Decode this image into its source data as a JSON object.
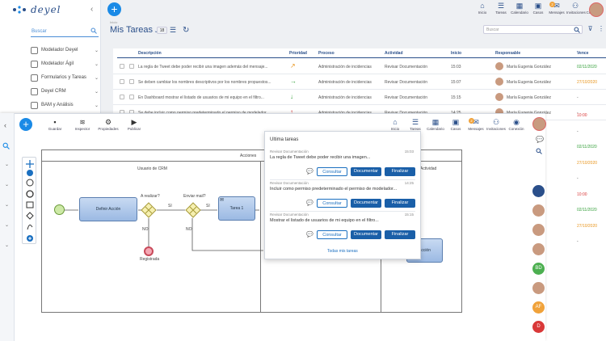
{
  "back": {
    "logo": "deyel",
    "search_placeholder": "Buscar",
    "sidebar": [
      "Modelador Deyel",
      "Modelador Ágil",
      "Formularios y Tareas",
      "Deyel CRM",
      "BAM y Análisis"
    ],
    "toolbar": [
      {
        "label": "Inicio",
        "icon": "home-icon"
      },
      {
        "label": "Tareas",
        "icon": "tasks-icon"
      },
      {
        "label": "Calendario",
        "icon": "calendar-icon"
      },
      {
        "label": "Casos",
        "icon": "briefcase-icon"
      },
      {
        "label": "Mensajes",
        "icon": "messages-icon",
        "badge": "2"
      },
      {
        "label": "Invitaciones",
        "icon": "invite-icon"
      },
      {
        "label": "Conexión",
        "icon": "connection-icon"
      }
    ],
    "breadcrumb": "Inicio",
    "title": "Mis Tareas",
    "count": "18",
    "search_placeholder_tasks": "Buscar",
    "columns": [
      "Descripción",
      "Prioridad",
      "Proceso",
      "Actividad",
      "Inicio",
      "Responsable",
      "Vence"
    ],
    "rows": [
      {
        "desc": "La regla de Tweet debe poder recibir una imagen además del mensaje...",
        "priority": "↗",
        "proceso": "Administración de incidencias",
        "actividad": "Revisar Documentación",
        "inicio": "15:03",
        "resp": "María Eugenia González",
        "vence": "02/11/2020",
        "vclass": "grn",
        "pclass": "org"
      },
      {
        "desc": "Se deben cambiar los nombres descriptivos por los nombres propuestos...",
        "priority": "→",
        "proceso": "Administración de incidencias",
        "actividad": "Revisar Documentación",
        "inicio": "15:07",
        "resp": "María Eugenia González",
        "vence": "27/10/2020",
        "vclass": "org",
        "pclass": "grn"
      },
      {
        "desc": "En Dashboard mostrar el listado de usuarios de mi equipo en el filtro...",
        "priority": "↓",
        "proceso": "Administración de incidencias",
        "actividad": "Revisar Documentación",
        "inicio": "15:15",
        "resp": "María Eugenia González",
        "vence": "-",
        "vclass": "",
        "pclass": "grn"
      },
      {
        "desc": "Se debe incluir como permiso predeterminado el permiso de modelador...",
        "priority": "↑",
        "proceso": "Administración de incidencias",
        "actividad": "Revisar Documentación",
        "inicio": "14:25",
        "resp": "María Eugenia González",
        "vence": "-",
        "vclass": "",
        "pclass": "red"
      }
    ],
    "right_dates": [
      {
        "v": "10:00",
        "c": "red"
      },
      {
        "v": "-",
        "c": ""
      },
      {
        "v": "02/11/2020",
        "c": "grn"
      },
      {
        "v": "27/10/2020",
        "c": "org"
      },
      {
        "v": "-",
        "c": ""
      },
      {
        "v": "10:00",
        "c": "red"
      },
      {
        "v": "02/11/2020",
        "c": "grn"
      },
      {
        "v": "27/10/2020",
        "c": "org"
      },
      {
        "v": "-",
        "c": ""
      }
    ]
  },
  "front": {
    "tools": [
      {
        "label": "Guardar",
        "icon": "save-icon"
      },
      {
        "label": "Inspector",
        "icon": "layers-icon"
      },
      {
        "label": "Propiedades",
        "icon": "gear-icon"
      },
      {
        "label": "Publicar",
        "icon": "play-icon"
      }
    ],
    "toolbar": [
      {
        "label": "Inicio",
        "icon": "home-icon"
      },
      {
        "label": "Tareas",
        "icon": "tasks-icon"
      },
      {
        "label": "Calendario",
        "icon": "calendar-icon"
      },
      {
        "label": "Casos",
        "icon": "briefcase-icon"
      },
      {
        "label": "Mensajes",
        "icon": "messages-icon",
        "badge": "2"
      },
      {
        "label": "Invitaciones",
        "icon": "invite-icon"
      },
      {
        "label": "Conexión",
        "icon": "connection-icon"
      }
    ],
    "diagram": {
      "pool_label": "Acciones",
      "lane1": "Usuario de CRM",
      "lane3": "Actividad",
      "task1": "Definir Acción",
      "gw1": "A realizar?",
      "gw2": "Enviar mail?",
      "task2": "Tarea 1",
      "si1": "SI",
      "si2": "SI",
      "no1": "NO",
      "no2": "NO",
      "end": "Registrada",
      "task3": "Acción"
    },
    "right_avatars": [
      {
        "text": "",
        "color": "#2a4f8a"
      },
      {
        "text": "",
        "color": "#c99a7f"
      },
      {
        "text": "",
        "color": "#c99a7f"
      },
      {
        "text": "",
        "color": "#c99a7f"
      },
      {
        "text": "BD",
        "color": "#4caf50"
      },
      {
        "text": "",
        "color": "#c99a7f"
      },
      {
        "text": "AF",
        "color": "#f0a23a"
      },
      {
        "text": "D",
        "color": "#d93838"
      }
    ]
  },
  "popup": {
    "title": "Ultima tareas",
    "items": [
      {
        "proc": "Revisar Documentación",
        "time": "15:03",
        "desc": "La regla de Tweet debe poder recibir una imagen..."
      },
      {
        "proc": "Revisar Documentación",
        "time": "14:25",
        "desc": "Incluir como permiso predeterminado el permiso de modelador..."
      },
      {
        "proc": "Revisar Documentación",
        "time": "15:15",
        "desc": "Mostrar el listado de usuarios de mi equipo en el filtro..."
      }
    ],
    "consult": "Consultar",
    "documentar": "Documentar",
    "finalizar": "Finalizar",
    "link": "Todas mis tareas"
  }
}
